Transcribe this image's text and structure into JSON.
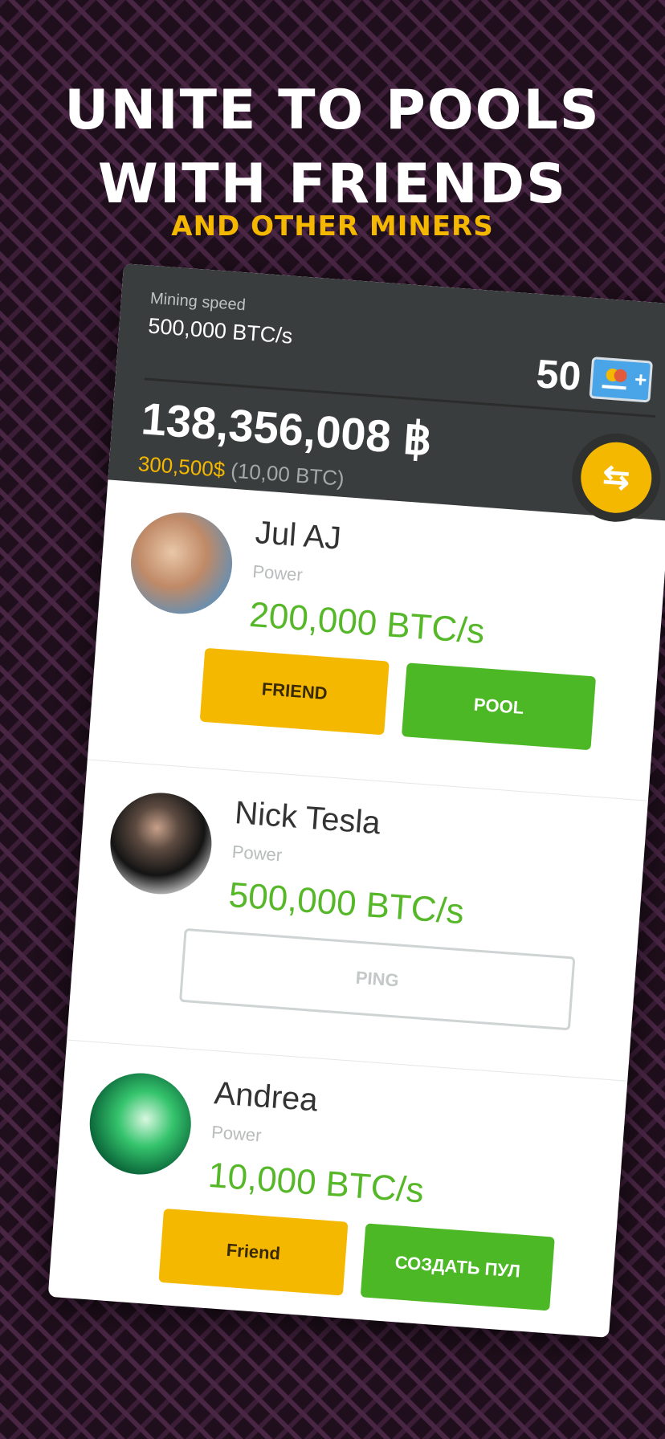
{
  "promo": {
    "headline_line1": "UNITE TO POOLS",
    "headline_line2": "WITH FRIENDS",
    "subheadline": "AND OTHER MINERS"
  },
  "header": {
    "mining_speed_label": "Mining speed",
    "mining_speed_value": "500,000 BTC/s",
    "credits": "50",
    "credits_icon": "card-add-icon",
    "balance": "138,356,008 ฿",
    "balance_usd": "300,500$",
    "balance_btc": "(10,00 BTC)",
    "swap_icon": "swap-arrows-icon"
  },
  "users": [
    {
      "name": "Jul AJ",
      "power_label": "Power",
      "power_value": "200,000 BTC/s",
      "primary_button": "FRIEND",
      "secondary_button": "POOL"
    },
    {
      "name": "Nick Tesla",
      "power_label": "Power",
      "power_value": "500,000 BTC/s",
      "ping_button": "PING"
    },
    {
      "name": "Andrea",
      "power_label": "Power",
      "power_value": "10,000 BTC/s",
      "primary_button": "Friend",
      "secondary_button": "СОЗДАТЬ ПУЛ"
    }
  ],
  "colors": {
    "accent_yellow": "#f5b800",
    "accent_green": "#4cb826",
    "header_dark": "#3a3d3d"
  }
}
